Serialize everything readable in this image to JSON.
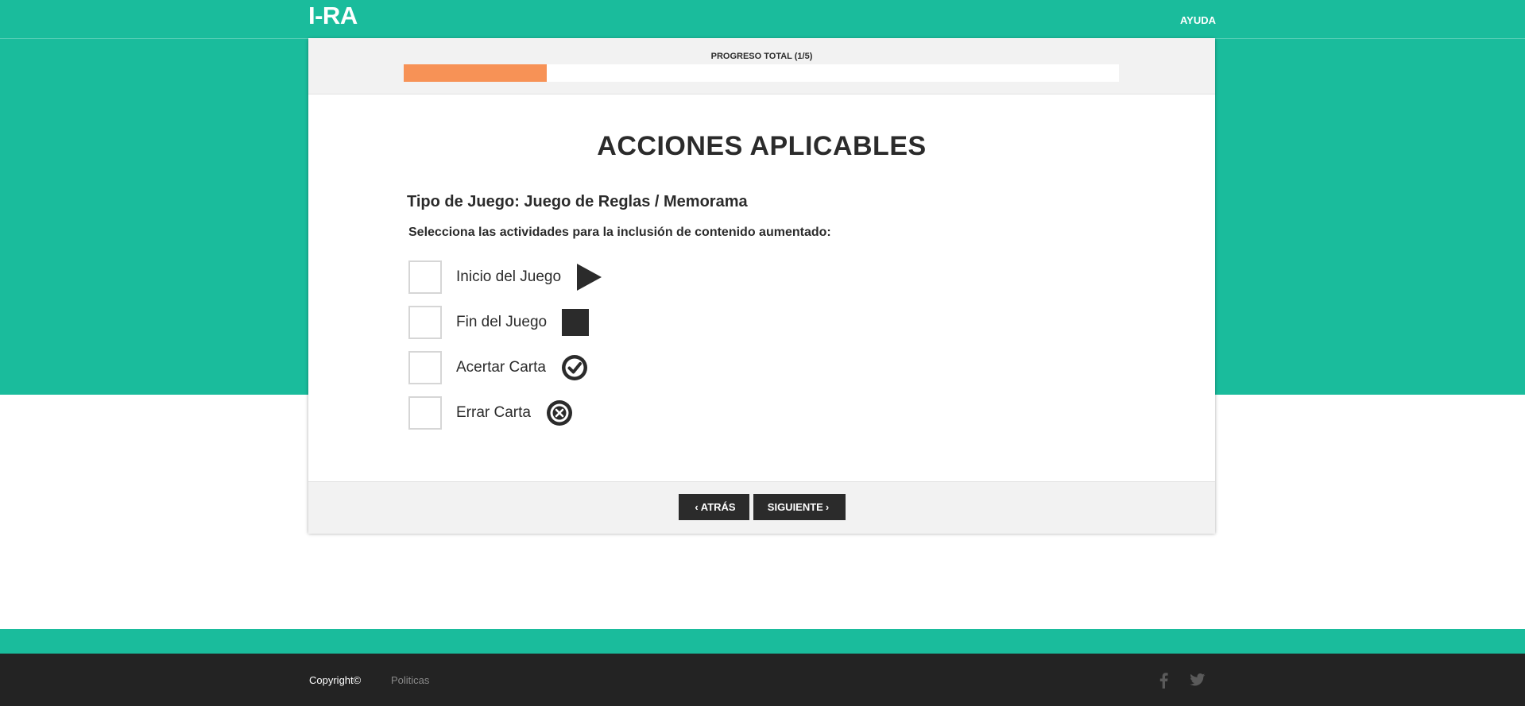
{
  "header": {
    "brand": "I-RA",
    "help_link": "AYUDA"
  },
  "progress": {
    "label": "PROGRESO TOTAL (1/5)",
    "value": 0.2,
    "color": "#f79256"
  },
  "main": {
    "title": "ACCIONES APLICABLES",
    "subtitle": "Tipo de Juego: Juego de Reglas / Memorama",
    "instruction": "Selecciona las actividades para la inclusión de contenido aumentado:",
    "options": [
      {
        "label": "Inicio del Juego",
        "icon": "play-icon",
        "checked": false
      },
      {
        "label": "Fin del Juego",
        "icon": "stop-icon",
        "checked": false
      },
      {
        "label": "Acertar Carta",
        "icon": "check-circle-icon",
        "checked": false
      },
      {
        "label": "Errar Carta",
        "icon": "x-circle-icon",
        "checked": false
      }
    ]
  },
  "actions": {
    "back_label": "ATRÁS",
    "next_label": "SIGUIENTE"
  },
  "footer": {
    "copyright": "Copyright©",
    "policies": "Politicas",
    "social": [
      "facebook-icon",
      "twitter-icon"
    ]
  },
  "colors": {
    "accent": "#1abc9c",
    "progress": "#f79256",
    "dark": "#232323",
    "button": "#2b2b2b"
  }
}
